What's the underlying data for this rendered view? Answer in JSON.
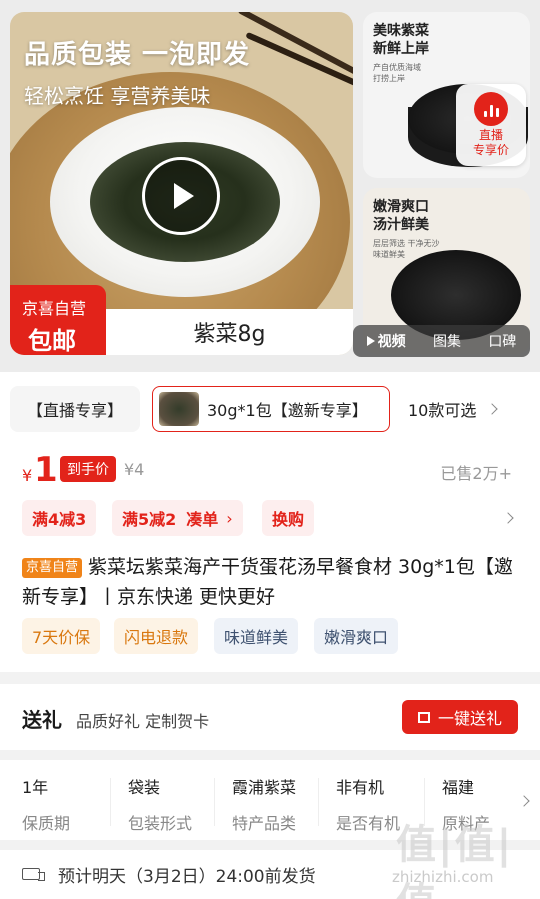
{
  "gallery": {
    "headline": "品质包装 一泡即发",
    "subline": "轻松烹饪 享营养美味",
    "badge_line1": "京喜自营",
    "badge_line2": "包邮",
    "product_name": "紫菜8g",
    "side1_title_1": "美味紫菜",
    "side1_title_2": "新鲜上岸",
    "side1_small_1": "产自优质海域",
    "side1_small_2": "打捞上岸",
    "side2_title_1": "嫩滑爽口",
    "side2_title_2": "汤汁鲜美",
    "side2_small_1": "层层筛选 干净无沙",
    "side2_small_2": "味道鲜美",
    "live_line1": "直播",
    "live_line2": "专享价",
    "tabs": [
      "视频",
      "图集",
      "口碑"
    ]
  },
  "spec_selector": {
    "chip1": "【直播专享】",
    "chip2": "30g*1包【邀新专享】",
    "more": "10款可选"
  },
  "price": {
    "currency": "¥",
    "value": "1",
    "badge": "到手价",
    "original": "¥4",
    "sold": "已售2万+"
  },
  "promos": [
    "满4减3",
    "满5减2",
    "凑单",
    "换购"
  ],
  "title": {
    "tag": "京喜自营",
    "text": "紫菜坛紫菜海产干货蛋花汤早餐食材 30g*1包【邀新专享】丨京东快递 更快更好"
  },
  "service_tags": [
    "7天价保",
    "闪电退款",
    "味道鲜美",
    "嫩滑爽口"
  ],
  "gift": {
    "title": "送礼",
    "sub": "品质好礼 定制贺卡",
    "button": "一键送礼"
  },
  "specs": [
    {
      "value": "1年",
      "key": "保质期"
    },
    {
      "value": "袋装",
      "key": "包装形式"
    },
    {
      "value": "霞浦紫菜",
      "key": "特产品类"
    },
    {
      "value": "非有机",
      "key": "是否有机"
    },
    {
      "value": "福建",
      "key": "原料产"
    }
  ],
  "shipping": {
    "text": "预计明天（3月2日）24:00前发货"
  },
  "watermark": {
    "text": "值|值|值",
    "sub": "zhizhizhi.com"
  },
  "colors": {
    "accent": "#e2231a",
    "jx_orange": "#f08419"
  }
}
